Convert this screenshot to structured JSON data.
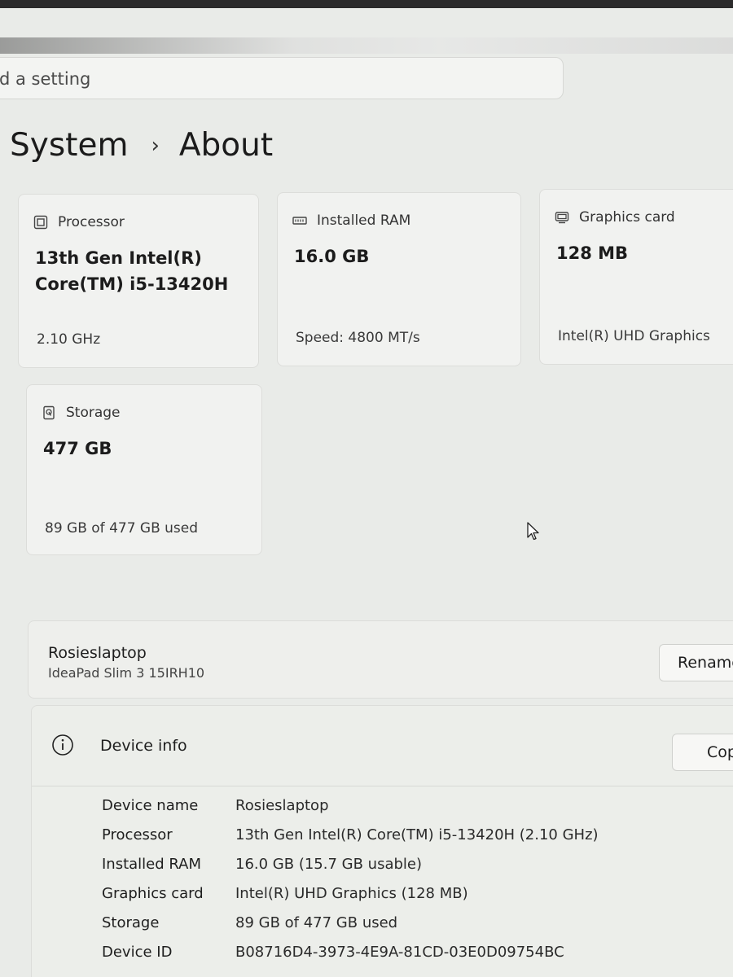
{
  "search": {
    "placeholder": "d a setting"
  },
  "breadcrumb": {
    "parent": "System",
    "separator": "›",
    "current": "About"
  },
  "specs_cards": [
    {
      "icon": "processor-icon",
      "label": "Processor",
      "value_line1": "13th Gen Intel(R)",
      "value_line2": "Core(TM) i5-13420H",
      "sub": "2.10 GHz"
    },
    {
      "icon": "ram-icon",
      "label": "Installed RAM",
      "value_line1": "16.0 GB",
      "sub": "Speed: 4800 MT/s"
    },
    {
      "icon": "graphics-card-icon",
      "label": "Graphics card",
      "value_line1": "128 MB",
      "sub": "Intel(R) UHD Graphics"
    },
    {
      "icon": "storage-icon",
      "label": "Storage",
      "value_line1": "477 GB",
      "sub": "89 GB of 477 GB used"
    }
  ],
  "device": {
    "name": "Rosieslaptop",
    "model": "IdeaPad Slim 3 15IRH10",
    "rename_label": "Rename"
  },
  "device_info": {
    "title": "Device info",
    "copy_label": "Copy",
    "rows": [
      {
        "label": "Device name",
        "value": "Rosieslaptop"
      },
      {
        "label": "Processor",
        "value": "13th Gen Intel(R) Core(TM) i5-13420H (2.10 GHz)"
      },
      {
        "label": "Installed RAM",
        "value": "16.0 GB (15.7 GB usable)"
      },
      {
        "label": "Graphics card",
        "value": "Intel(R) UHD Graphics (128 MB)"
      },
      {
        "label": "Storage",
        "value": "89 GB of 477 GB used"
      },
      {
        "label": "Device ID",
        "value": "B08716D4-3973-4E9A-81CD-03E0D09754BC"
      }
    ]
  }
}
